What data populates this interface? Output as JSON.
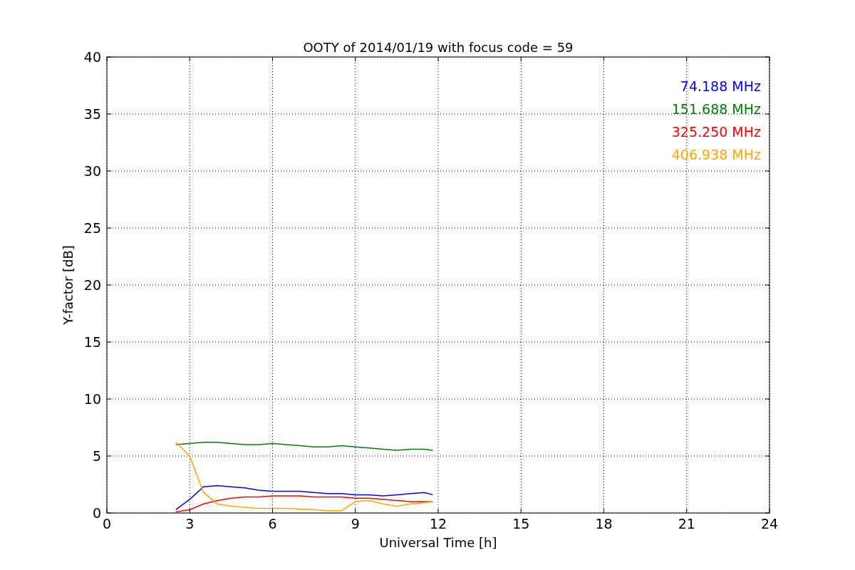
{
  "figure": {
    "chart_data": {
      "type": "line",
      "title": "OOTY of 2014/01/19 with focus code = 59",
      "xlabel": "Universal Time [h]",
      "ylabel": "Y-factor [dB]",
      "x": [
        2.5,
        3,
        3.5,
        4,
        4.5,
        5,
        5.5,
        6,
        6.5,
        7,
        7.5,
        8,
        8.5,
        9,
        9.5,
        10,
        10.5,
        11,
        11.5,
        11.8
      ],
      "series": [
        {
          "name": "74.188 MHz",
          "color": "#0000ff",
          "values": [
            0.3,
            1.2,
            2.3,
            2.4,
            2.3,
            2.2,
            2.0,
            1.9,
            1.9,
            1.9,
            1.8,
            1.7,
            1.7,
            1.6,
            1.6,
            1.5,
            1.6,
            1.7,
            1.8,
            1.6
          ]
        },
        {
          "name": "151.688 MHz",
          "color": "#008000",
          "values": [
            6.0,
            6.1,
            6.2,
            6.2,
            6.1,
            6.0,
            6.0,
            6.1,
            6.0,
            5.9,
            5.8,
            5.8,
            5.9,
            5.8,
            5.7,
            5.6,
            5.5,
            5.6,
            5.6,
            5.5
          ]
        },
        {
          "name": "325.250 MHz",
          "color": "#ff0000",
          "values": [
            0.1,
            0.3,
            0.8,
            1.1,
            1.3,
            1.4,
            1.4,
            1.5,
            1.5,
            1.5,
            1.4,
            1.4,
            1.4,
            1.3,
            1.3,
            1.2,
            1.1,
            1.0,
            1.0,
            1.0
          ]
        },
        {
          "name": "406.938 MHz",
          "color": "#ffa500",
          "values": [
            6.2,
            5.0,
            1.8,
            0.8,
            0.6,
            0.5,
            0.4,
            0.4,
            0.4,
            0.35,
            0.3,
            0.2,
            0.2,
            1.0,
            1.1,
            0.8,
            0.6,
            0.8,
            0.9,
            1.0
          ]
        }
      ],
      "grid": true,
      "xlim": [
        0,
        24
      ],
      "ylim": [
        0,
        40
      ],
      "xticks": [
        0,
        3,
        6,
        9,
        12,
        15,
        18,
        21,
        24
      ],
      "yticks": [
        0,
        5,
        10,
        15,
        20,
        25,
        30,
        35,
        40
      ]
    }
  }
}
